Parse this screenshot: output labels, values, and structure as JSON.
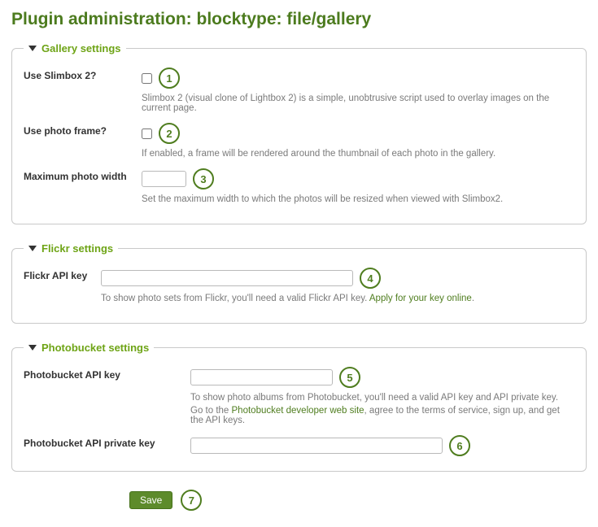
{
  "title": "Plugin administration: blocktype: file/gallery",
  "sections": {
    "gallery": {
      "legend": "Gallery settings",
      "slimbox": {
        "label": "Use Slimbox 2?",
        "help": "Slimbox 2 (visual clone of Lightbox 2) is a simple, unobtrusive script used to overlay images on the current page.",
        "marker": "1"
      },
      "frame": {
        "label": "Use photo frame?",
        "help": "If enabled, a frame will be rendered around the thumbnail of each photo in the gallery.",
        "marker": "2"
      },
      "maxwidth": {
        "label": "Maximum photo width",
        "help": "Set the maximum width to which the photos will be resized when viewed with Slimbox2.",
        "marker": "3"
      }
    },
    "flickr": {
      "legend": "Flickr settings",
      "api": {
        "label": "Flickr API key",
        "help_pre": "To show photo sets from Flickr, you'll need a valid Flickr API key. ",
        "link": "Apply for your key online",
        "help_post": ".",
        "marker": "4"
      }
    },
    "pb": {
      "legend": "Photobucket settings",
      "api": {
        "label": "Photobucket API key",
        "help1": "To show photo albums from Photobucket, you'll need a valid API key and API private key.",
        "help2_pre": "Go to the ",
        "link": "Photobucket developer web site",
        "help2_post": ", agree to the terms of service, sign up, and get the API keys.",
        "marker": "5"
      },
      "priv": {
        "label": "Photobucket API private key",
        "marker": "6"
      }
    }
  },
  "save": {
    "label": "Save",
    "marker": "7"
  }
}
